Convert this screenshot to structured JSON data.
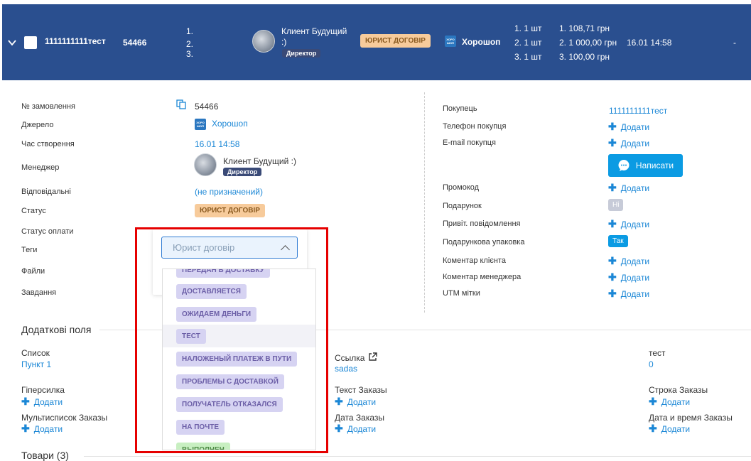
{
  "order_row": {
    "name": "1111111111тест",
    "order_id": "54466",
    "items_index": [
      "1.",
      "2.",
      "3."
    ],
    "client_name": "Клиент Будущий :)",
    "client_role": "Директор",
    "status": "ЮРИСТ ДОГОВІР",
    "source": "Хорошоп",
    "quantities": [
      "1. 1 шт",
      "2. 1 шт",
      "3. 1 шт"
    ],
    "prices": [
      "1. 108,71 грн",
      "2. 1 000,00 грн",
      "3. 100,00 грн"
    ],
    "date": "16.01 14:58",
    "dash": "-"
  },
  "details": {
    "labels": {
      "order_no": "№ замовлення",
      "source": "Джерело",
      "created": "Час створення",
      "manager": "Менеджер",
      "responsible": "Відповідальні",
      "status": "Статус",
      "payment_status": "Статус оплати",
      "tags": "Теги",
      "files": "Файли",
      "tasks": "Завдання"
    },
    "order_no": "54466",
    "source": "Хорошоп",
    "created": "16.01 14:58",
    "manager_name": "Клиент Будущий :)",
    "manager_role": "Директор",
    "responsible": "(не призначений)",
    "status": "ЮРИСТ ДОГОВІР"
  },
  "buyer": {
    "labels": {
      "buyer": "Покупець",
      "phone": "Телефон покупця",
      "email": "E-mail покупця",
      "promo": "Промокод",
      "gift": "Подарунок",
      "greeting": "Привіт. повідомлення",
      "gift_pack": "Подарункова упаковка",
      "client_comment": "Коментар клієнта",
      "manager_comment": "Коментар менеджера",
      "utm": "UTM мітки"
    },
    "buyer_name": "1111111111тест",
    "add": "Додати",
    "write_button": "Написати",
    "gift_value": "Ні",
    "gift_pack_value": "Так"
  },
  "extra": {
    "title": "Додаткові поля",
    "fields": {
      "list_label": "Список",
      "list_value": "Пункт 1",
      "link_label": "Ссылка",
      "link_value": "sadas",
      "test_label": "тест",
      "test_value": "0",
      "hyperlink_label": "Гіперсилка",
      "text_orders_label": "Текст Заказы",
      "string_orders_label": "Строка Заказы",
      "multilist_label": "Мультисписок Заказы",
      "date_orders_label": "Дата Заказы",
      "datetime_orders_label": "Дата и время Заказы"
    },
    "add": "Додати"
  },
  "goods_title": "Товари (3)",
  "status_dropdown": {
    "selected": "Юрист договір",
    "options": [
      "ПЕРЕДАН В ДОСТАВКУ",
      "ДОСТАВЛЯЕТСЯ",
      "ОЖИДАЕМ ДЕНЬГИ",
      "ТЕСТ",
      "НАЛОЖЕНЫЙ ПЛАТЕЖ В ПУТИ",
      "ПРОБЛЕМЫ С ДОСТАВКОЙ",
      "ПОЛУЧАТЕЛЬ ОТКАЗАЛСЯ",
      "НА ПОЧТЕ",
      "ВЫПОЛНЕН"
    ]
  },
  "shop_icon_text": "ХОРО ШОП"
}
